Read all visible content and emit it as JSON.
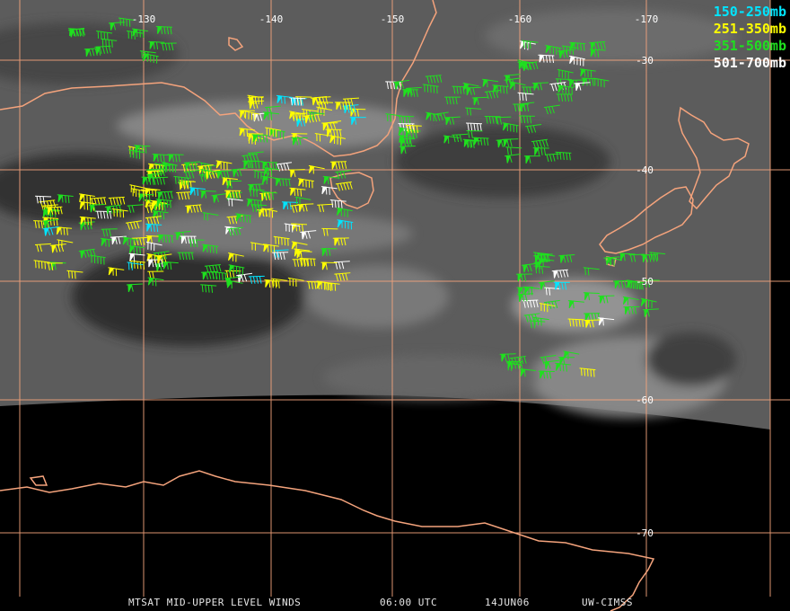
{
  "map": {
    "longitude_labels": [
      "-130",
      "-140",
      "-150",
      "-160",
      "-170"
    ],
    "latitude_labels": [
      "-30",
      "-40",
      "-50",
      "-60",
      "-70"
    ],
    "colors": {
      "grid": "#f4a37c",
      "coast": "#f4a37c",
      "space": "#000000"
    }
  },
  "legend": [
    {
      "label": "150-250mb",
      "color": "#00e5ff"
    },
    {
      "label": "251-350mb",
      "color": "#ffff00"
    },
    {
      "label": "351-500mb",
      "color": "#1fe01f"
    },
    {
      "label": "501-700mb",
      "color": "#ffffff"
    }
  ],
  "footer": {
    "product": "MTSAT MID-UPPER LEVEL WINDS",
    "time": "06:00 UTC",
    "date": "14JUN06",
    "source": "UW-CIMSS"
  }
}
